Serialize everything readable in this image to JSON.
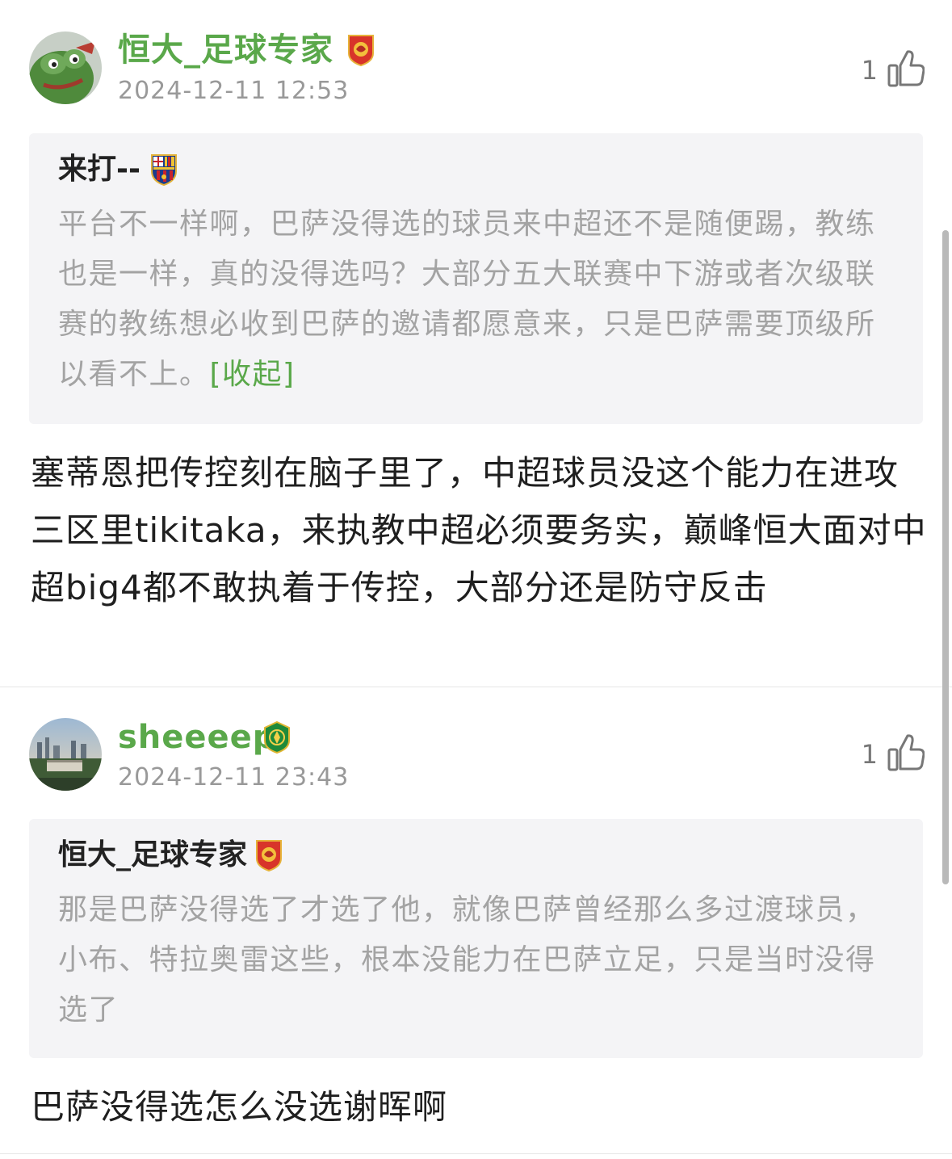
{
  "comments": [
    {
      "username": "恒大_足球专家",
      "badge": "guangzhou-club-badge",
      "timestamp": "2024-12-11 12:53",
      "likes": "1",
      "avatar": "frog-avatar",
      "quote": {
        "author": "来打--",
        "badge": "barcelona-club-badge",
        "text": "平台不一样啊，巴萨没得选的球员来中超还不是随便踢，教练也是一样，真的没得选吗？大部分五大联赛中下游或者次级联赛的教练想必收到巴萨的邀请都愿意来，只是巴萨需要顶级所以看不上。",
        "collapse_label": "[收起]"
      },
      "body": "塞蒂恩把传控刻在脑子里了，中超球员没这个能力在进攻三区里tikitaka，来执教中超必须要务实，巅峰恒大面对中超big4都不敢执着于传控，大部分还是防守反击"
    },
    {
      "username": "sheeeep",
      "badge": "beijing-guoan-badge",
      "timestamp": "2024-12-11 23:43",
      "likes": "1",
      "avatar": "city-skyline-avatar",
      "quote": {
        "author": "恒大_足球专家",
        "badge": "guangzhou-club-badge",
        "text": "那是巴萨没得选了才选了他，就像巴萨曾经那么多过渡球员，小布、特拉奥雷这些，根本没能力在巴萨立足，只是当时没得选了"
      },
      "body": "巴萨没得选怎么没选谢晖啊"
    }
  ],
  "icons": {
    "like": "thumbs-up-icon"
  },
  "colors": {
    "username": "#5aa84a",
    "timestamp": "#999999",
    "quote_bg": "#f4f4f6",
    "quote_text": "#a3a3a3",
    "body_text": "#1f1f1f",
    "link": "#5aa84a"
  }
}
